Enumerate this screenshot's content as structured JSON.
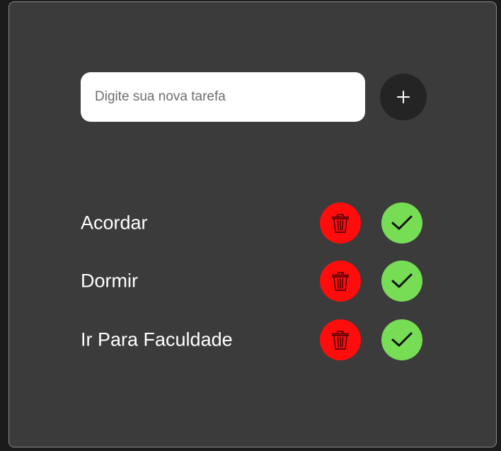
{
  "colors": {
    "background": "#1b1b1b",
    "card": "#3b3b3b",
    "input_bg": "#ffffff",
    "add_button": "#242424",
    "delete_button": "#ff0d0d",
    "done_button": "#77dd55"
  },
  "new_task": {
    "placeholder": "Digite sua nova tarefa",
    "value": "",
    "add_icon": "plus-icon"
  },
  "tasks": [
    {
      "label": "Acordar",
      "delete_icon": "trash-icon",
      "done_icon": "check-icon"
    },
    {
      "label": "Dormir",
      "delete_icon": "trash-icon",
      "done_icon": "check-icon"
    },
    {
      "label": "Ir Para Faculdade",
      "delete_icon": "trash-icon",
      "done_icon": "check-icon"
    }
  ]
}
